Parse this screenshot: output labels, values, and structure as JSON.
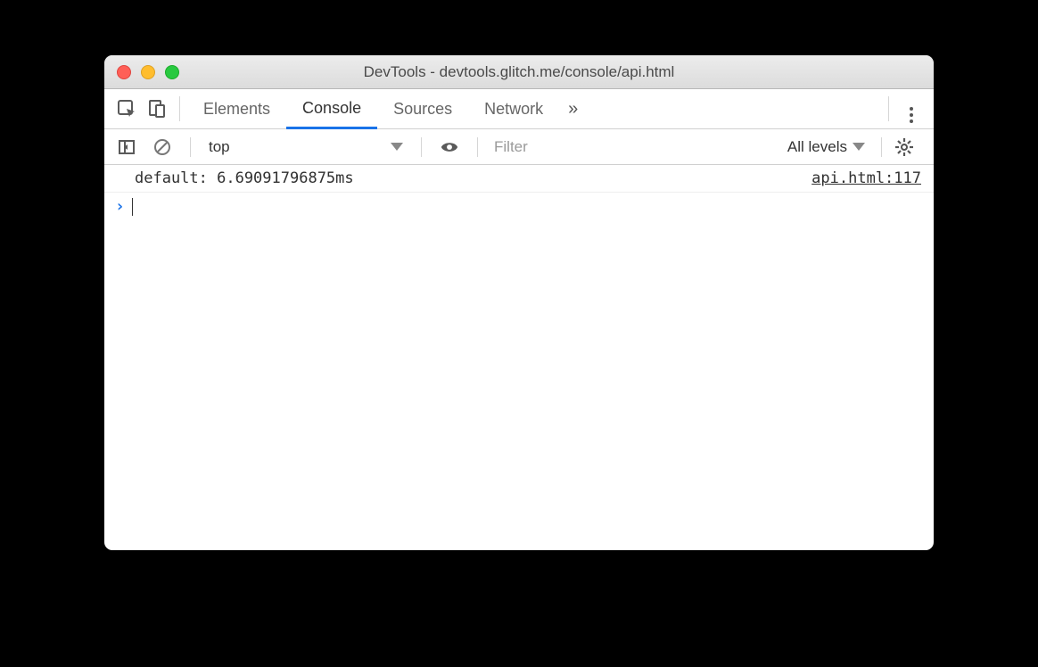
{
  "window": {
    "title": "DevTools - devtools.glitch.me/console/api.html"
  },
  "tabs": {
    "items": [
      "Elements",
      "Console",
      "Sources",
      "Network"
    ],
    "active_index": 1,
    "overflow_glyph": "»"
  },
  "filter": {
    "context": "top",
    "placeholder": "Filter",
    "levels_label": "All levels"
  },
  "console": {
    "rows": [
      {
        "message": "default: 6.69091796875ms",
        "source": "api.html:117"
      }
    ],
    "prompt_glyph": "›"
  }
}
